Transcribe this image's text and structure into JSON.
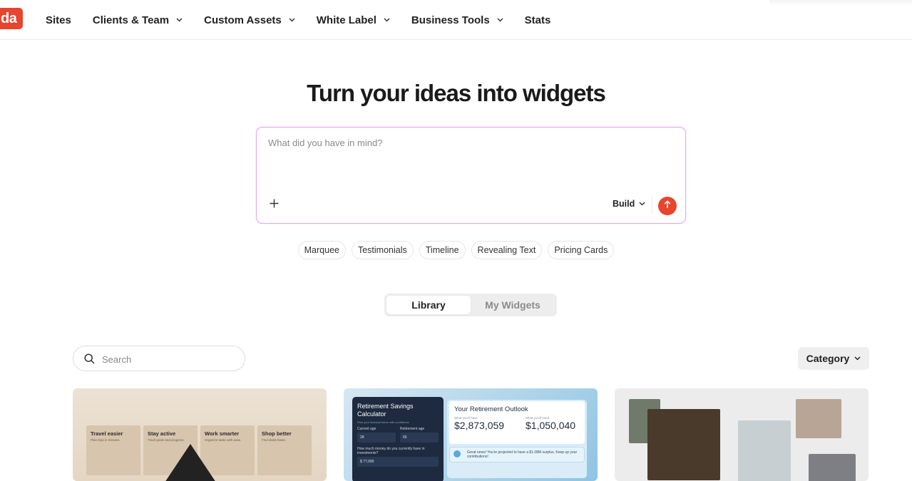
{
  "brand": {
    "logo_text": "da",
    "accent": "#e8452e"
  },
  "nav": {
    "items": [
      {
        "label": "Sites",
        "has_dropdown": false
      },
      {
        "label": "Clients & Team",
        "has_dropdown": true
      },
      {
        "label": "Custom Assets",
        "has_dropdown": true
      },
      {
        "label": "White Label",
        "has_dropdown": true
      },
      {
        "label": "Business Tools",
        "has_dropdown": true
      },
      {
        "label": "Stats",
        "has_dropdown": false
      }
    ]
  },
  "hero": {
    "title": "Turn your ideas into widgets"
  },
  "prompt": {
    "placeholder": "What did you have in mind?",
    "value": "",
    "mode_label": "Build",
    "add_icon": "plus-icon",
    "send_icon": "arrow-up-icon"
  },
  "suggestions": [
    "Marquee",
    "Testimonials",
    "Timeline",
    "Revealing Text",
    "Pricing Cards"
  ],
  "tabs": {
    "active": "Library",
    "inactive": "My Widgets"
  },
  "search": {
    "placeholder": "Search",
    "value": "",
    "icon": "search-icon"
  },
  "category": {
    "label": "Category"
  },
  "cards": {
    "travel": {
      "tiles": [
        {
          "title": "Travel easier",
          "sub": "Plan trips in minutes."
        },
        {
          "title": "Stay active",
          "sub": "Track goals and progress."
        },
        {
          "title": "Work smarter",
          "sub": "Organize tasks with ease."
        },
        {
          "title": "Shop better",
          "sub": "Find deals faster."
        }
      ]
    },
    "retirement": {
      "calc_title": "Retirement Savings Calculator",
      "calc_sub": "Plan your financial future with confidence",
      "current_age_label": "Current age",
      "current_age": "28",
      "retirement_age_label": "Retirement age",
      "retirement_age": "65",
      "invest_label": "How much money do you currently have in investments?",
      "invest_value": "$ 77,000",
      "outlook_title": "Your Retirement Outlook",
      "have_label": "What you'll have",
      "have_value": "$2,873,059",
      "need_label": "What you'll need",
      "need_value": "$1,050,040",
      "note": "Great news! You're projected to have a $1.08M surplus. Keep up your contributions!"
    }
  }
}
